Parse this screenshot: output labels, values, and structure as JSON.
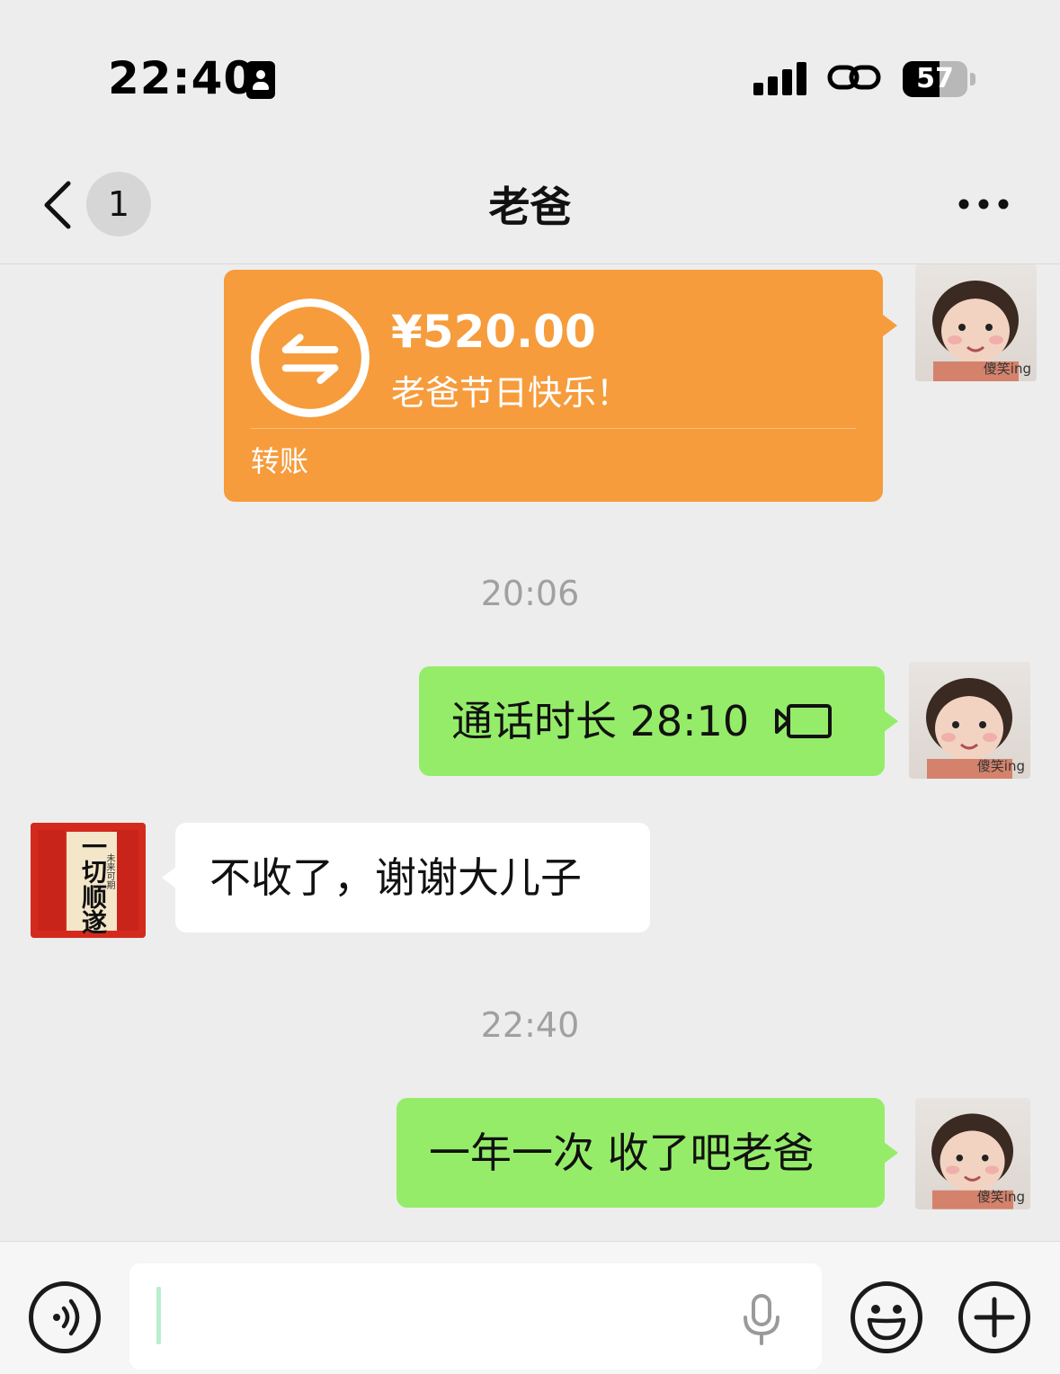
{
  "status_bar": {
    "time": "22:40",
    "battery": "57"
  },
  "nav": {
    "unread_count": "1",
    "title": "老爸"
  },
  "messages": {
    "transfer": {
      "amount": "¥520.00",
      "note": "老爸节日快乐！",
      "label": "转账",
      "direction": "outgoing"
    },
    "timestamp_1": "20:06",
    "call": {
      "text": "通话时长 28:10",
      "icon": "video-call-icon",
      "direction": "outgoing"
    },
    "reply": {
      "text": "不收了，谢谢大儿子",
      "direction": "incoming"
    },
    "timestamp_2": "22:40",
    "last": {
      "text": "一年一次 收了吧老爸",
      "direction": "outgoing"
    }
  },
  "avatars": {
    "self_caption": "傻笑ing",
    "contact_text": "一切顺遂",
    "contact_subtext": "未来可期"
  },
  "input_bar": {
    "value": "",
    "left_icon": "voice-mode-icon",
    "mic_icon": "mic-icon",
    "emoji_icon": "emoji-icon",
    "plus_icon": "plus-icon"
  },
  "colors": {
    "background": "#ededed",
    "sent_bubble": "#95ec69",
    "received_bubble": "#ffffff",
    "transfer_card": "#f69c3c",
    "timestamp": "#a0a0a0"
  }
}
